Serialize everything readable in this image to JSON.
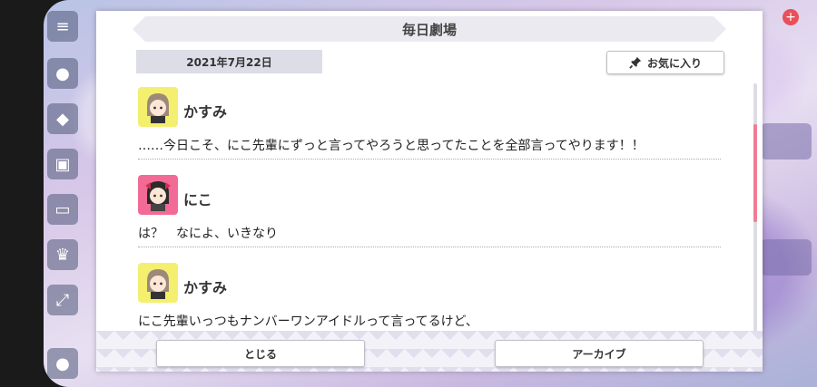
{
  "dialog": {
    "title": "毎日劇場",
    "date": "2021年7月22日",
    "favorite_label": "お気に入り",
    "messages": [
      {
        "speaker": "かすみ",
        "text": "……今日こそ、にこ先輩にずっと言ってやろうと思ってたことを全部言ってやります！！"
      },
      {
        "speaker": "にこ",
        "text": "は？　なによ、いきなり"
      },
      {
        "speaker": "かすみ",
        "text": "にこ先輩いっつもナンバーワンアイドルって言ってるけど、"
      }
    ],
    "close_label": "とじる",
    "archive_label": "アーカイブ"
  },
  "colors": {
    "accent_scroll": "#f07d92",
    "kasumi_bg": "#f4ef6f",
    "nico_bg": "#f26b96"
  },
  "icons": {
    "favorite": "pin-icon",
    "menu": "hamburger-icon"
  }
}
